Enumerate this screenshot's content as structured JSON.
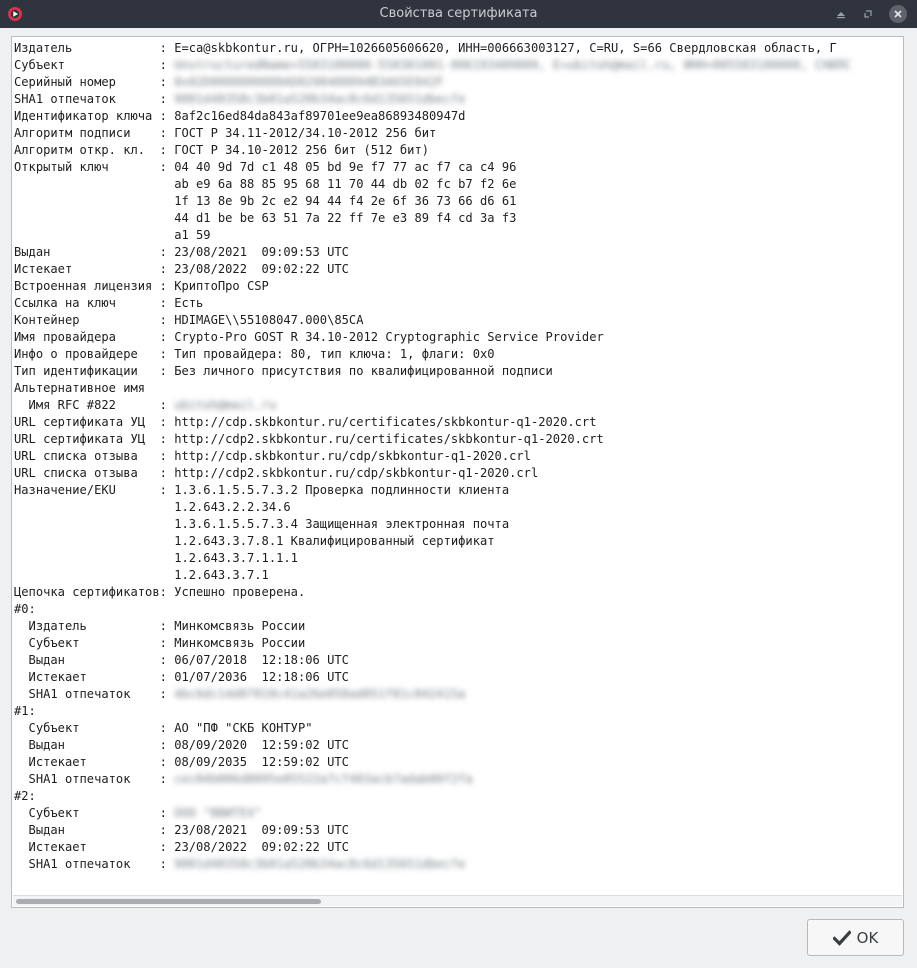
{
  "window": {
    "title": "Свойства сертификата"
  },
  "icons": {
    "app": "app-logo-icon",
    "minimize": "minimize-icon",
    "restore": "restore-icon",
    "close": "close-icon",
    "ok": "check-icon"
  },
  "colors": {
    "titlebar": "#2f343f",
    "pane_bg": "#ffffff",
    "text": "#1e1e1e",
    "accent_red": "#d9334b"
  },
  "buttons": {
    "ok_label": "OK"
  },
  "details": [
    {
      "label": "Издатель            : ",
      "value": "E=ca@skbkontur.ru, ОГРН=1026605606620, ИНН=006663003127, C=RU, S=66 Свердловская область, Г",
      "blurred": false
    },
    {
      "label": "Субъект             : ",
      "value": "UnstructuredName=5503100000-550301001-006193409809, E=ubitoh@mail.ru, ИНН=005503100008, СНИЛС",
      "blurred": true
    },
    {
      "label": "Серийный номер      : ",
      "value": "0x02D0000000000AD0290400094B3A65E042F",
      "blurred": true
    },
    {
      "label": "SHA1 отпечаток      : ",
      "value": "9001d48358c3b01a520b34ac8c6d135651dbecfe",
      "blurred": true
    },
    {
      "label": "Идентификатор ключа : ",
      "value": "8af2c16ed84da843af89701ee9ea86893480947d",
      "blurred": false
    },
    {
      "label": "Алгоритм подписи    : ",
      "value": "ГОСТ Р 34.11-2012/34.10-2012 256 бит",
      "blurred": false
    },
    {
      "label": "Алгоритм откр. кл.  : ",
      "value": "ГОСТ Р 34.10-2012 256 бит (512 бит)",
      "blurred": false
    },
    {
      "label": "Открытый ключ       : ",
      "value": "04 40 9d 7d c1 48 05 bd 9e f7 77 ac f7 ca c4 96",
      "blurred": false
    },
    {
      "label": "                      ",
      "value": "ab e9 6a 88 85 95 68 11 70 44 db 02 fc b7 f2 6e",
      "blurred": false
    },
    {
      "label": "                      ",
      "value": "1f 13 8e 9b 2c e2 94 44 f4 2e 6f 36 73 66 d6 61",
      "blurred": false
    },
    {
      "label": "                      ",
      "value": "44 d1 be be 63 51 7a 22 ff 7e e3 89 f4 cd 3a f3",
      "blurred": false
    },
    {
      "label": "                      ",
      "value": "a1 59",
      "blurred": false
    },
    {
      "label": "Выдан               : ",
      "value": "23/08/2021  09:09:53 UTC",
      "blurred": false
    },
    {
      "label": "Истекает            : ",
      "value": "23/08/2022  09:02:22 UTC",
      "blurred": false
    },
    {
      "label": "Встроенная лицензия : ",
      "value": "КриптоПро CSP",
      "blurred": false
    },
    {
      "label": "Ссылка на ключ      : ",
      "value": "Есть",
      "blurred": false
    },
    {
      "label": "Контейнер           : ",
      "value": "HDIMAGE\\\\55108047.000\\85CA",
      "blurred": false
    },
    {
      "label": "Имя провайдера      : ",
      "value": "Crypto-Pro GOST R 34.10-2012 Cryptographic Service Provider",
      "blurred": false
    },
    {
      "label": "Инфо о провайдере   : ",
      "value": "Тип провайдера: 80, тип ключа: 1, флаги: 0x0",
      "blurred": false
    },
    {
      "label": "Тип идентификации   : ",
      "value": "Без личного присутствия по квалифицированной подписи",
      "blurred": false
    },
    {
      "label": "Альтернативное имя",
      "value": "",
      "blurred": false
    },
    {
      "label": "  Имя RFC #822      : ",
      "value": "ubitoh@mail.ru",
      "blurred": true
    },
    {
      "label": "URL сертификата УЦ  : ",
      "value": "http://cdp.skbkontur.ru/certificates/skbkontur-q1-2020.crt",
      "blurred": false
    },
    {
      "label": "URL сертификата УЦ  : ",
      "value": "http://cdp2.skbkontur.ru/certificates/skbkontur-q1-2020.crt",
      "blurred": false
    },
    {
      "label": "URL списка отзыва   : ",
      "value": "http://cdp.skbkontur.ru/cdp/skbkontur-q1-2020.crl",
      "blurred": false
    },
    {
      "label": "URL списка отзыва   : ",
      "value": "http://cdp2.skbkontur.ru/cdp/skbkontur-q1-2020.crl",
      "blurred": false
    },
    {
      "label": "Назначение/EKU      : ",
      "value": "1.3.6.1.5.5.7.3.2 Проверка подлинности клиента",
      "blurred": false
    },
    {
      "label": "                      ",
      "value": "1.2.643.2.2.34.6",
      "blurred": false
    },
    {
      "label": "                      ",
      "value": "1.3.6.1.5.5.7.3.4 Защищенная электронная почта",
      "blurred": false
    },
    {
      "label": "                      ",
      "value": "1.2.643.3.7.8.1 Квалифицированный сертификат",
      "blurred": false
    },
    {
      "label": "                      ",
      "value": "1.2.643.3.7.1.1.1",
      "blurred": false
    },
    {
      "label": "                      ",
      "value": "1.2.643.3.7.1",
      "blurred": false
    },
    {
      "label": "Цепочка сертификатов: ",
      "value": "Успешно проверена.",
      "blurred": false
    },
    {
      "label": "#0:",
      "value": "",
      "blurred": false
    },
    {
      "label": "  Издатель          : ",
      "value": "Минкомсвязь России",
      "blurred": false
    },
    {
      "label": "  Субъект           : ",
      "value": "Минкомсвязь России",
      "blurred": false
    },
    {
      "label": "  Выдан             : ",
      "value": "06/07/2018  12:18:06 UTC",
      "blurred": false
    },
    {
      "label": "  Истекает          : ",
      "value": "01/07/2036  12:18:06 UTC",
      "blurred": false
    },
    {
      "label": "  SHA1 отпечаток    : ",
      "value": "4bc6dc14d07018c41a26e058ad051f81c042415a",
      "blurred": true
    },
    {
      "label": "#1:",
      "value": "",
      "blurred": false
    },
    {
      "label": "  Субъект           : ",
      "value": "АО \"ПФ \"СКБ КОНТУР\"",
      "blurred": false
    },
    {
      "label": "  Выдан             : ",
      "value": "08/09/2020  12:59:02 UTC",
      "blurred": false
    },
    {
      "label": "  Истекает          : ",
      "value": "08/09/2035  12:59:02 UTC",
      "blurred": false
    },
    {
      "label": "  SHA1 отпечаток    : ",
      "value": "cec04b006d8095e85522a7cf403acb7adab00f2fa",
      "blurred": true
    },
    {
      "label": "#2:",
      "value": "",
      "blurred": false
    },
    {
      "label": "  Субъект           : ",
      "value": "ООО \"ВВИТЕХ\"",
      "blurred": true
    },
    {
      "label": "  Выдан             : ",
      "value": "23/08/2021  09:09:53 UTC",
      "blurred": false
    },
    {
      "label": "  Истекает          : ",
      "value": "23/08/2022  09:02:22 UTC",
      "blurred": false
    },
    {
      "label": "  SHA1 отпечаток    : ",
      "value": "9001d48358c3b01a520b34ac8c6d135651dbecfe",
      "blurred": true
    }
  ]
}
